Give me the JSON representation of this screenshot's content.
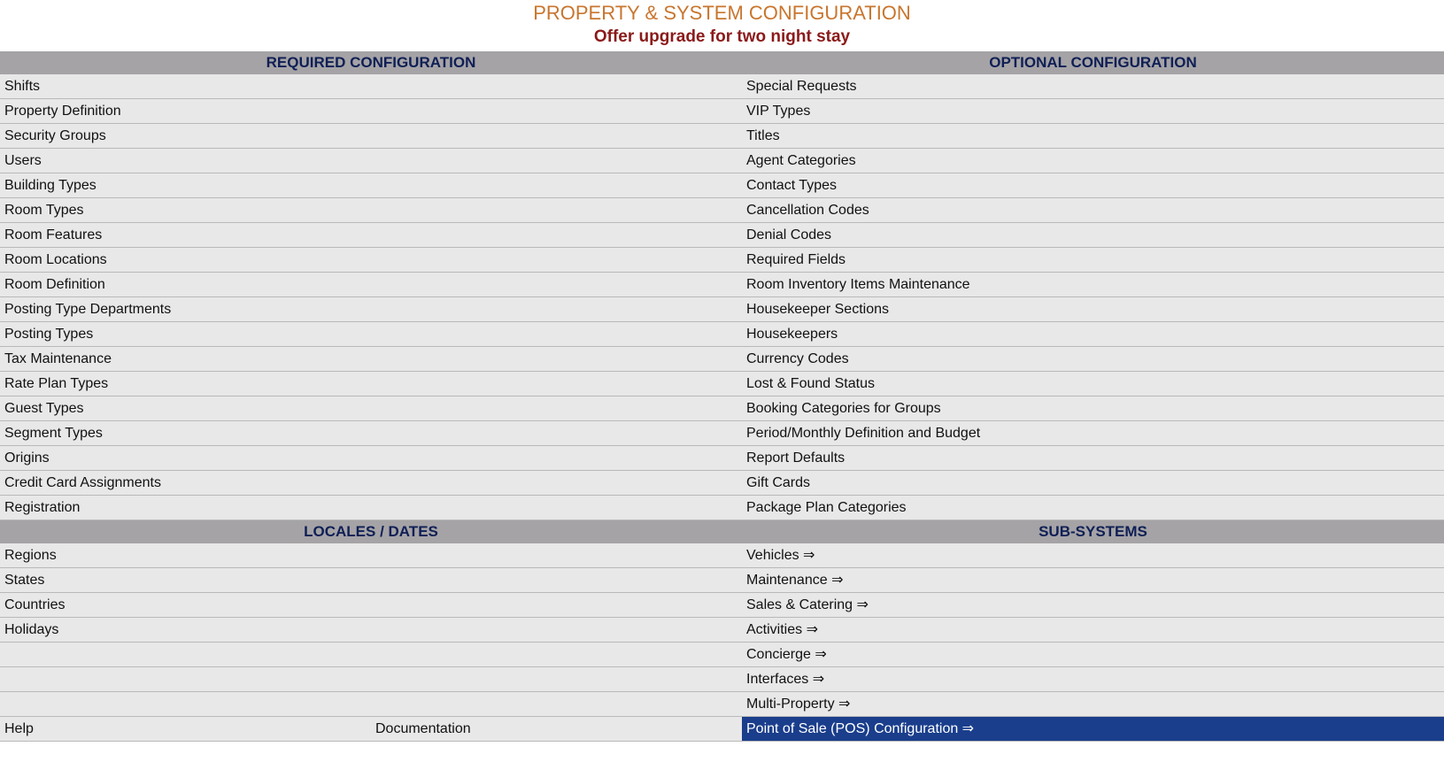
{
  "header": {
    "title": "PROPERTY & SYSTEM CONFIGURATION",
    "subtitle": "Offer upgrade for two night stay"
  },
  "sections": {
    "required_title": "REQUIRED CONFIGURATION",
    "optional_title": "OPTIONAL CONFIGURATION",
    "locales_title": "LOCALES / DATES",
    "subsystems_title": "SUB-SYSTEMS"
  },
  "required": [
    "Shifts",
    "Property Definition",
    "Security Groups",
    "Users",
    "Building Types",
    "Room Types",
    "Room Features",
    "Room Locations",
    "Room Definition",
    "Posting Type Departments",
    "Posting Types",
    "Tax Maintenance",
    "Rate Plan Types",
    "Guest Types",
    "Segment Types",
    "Origins",
    "Credit Card Assignments",
    "Registration"
  ],
  "optional": [
    "Special Requests",
    "VIP Types",
    "Titles",
    "Agent Categories",
    "Contact Types",
    "Cancellation Codes",
    "Denial Codes",
    "Required Fields",
    "Room Inventory Items Maintenance",
    "Housekeeper Sections",
    "Housekeepers",
    "Currency Codes",
    "Lost & Found Status",
    "Booking Categories for Groups",
    "Period/Monthly Definition and Budget",
    "Report Defaults",
    "Gift Cards",
    "Package Plan Categories"
  ],
  "locales": [
    "Regions",
    "States",
    "Countries",
    "Holidays",
    "",
    "",
    ""
  ],
  "subsystems": [
    "Vehicles ⇒",
    "Maintenance ⇒",
    "Sales & Catering ⇒",
    "Activities ⇒",
    "Concierge ⇒",
    "Interfaces ⇒",
    "Multi-Property ⇒"
  ],
  "footer": {
    "help": "Help",
    "documentation": "Documentation",
    "pos": "Point of Sale (POS) Configuration ⇒"
  },
  "colors": {
    "title": "#c8762e",
    "subtitle": "#8b1a1a",
    "header_bg": "#a5a3a6",
    "header_text": "#0f1f55",
    "row_bg": "#e8e8e8",
    "selected_bg": "#1a3e8c"
  }
}
